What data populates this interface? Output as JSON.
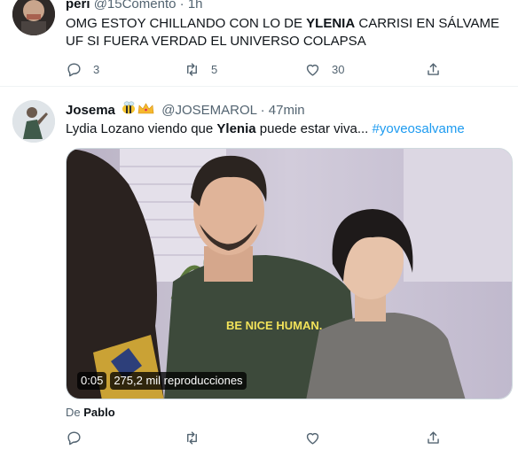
{
  "tweets": [
    {
      "name": "peri",
      "handle": "@15Comento",
      "separator": "·",
      "time": "1h",
      "text_pre": "OMG ESTOY CHILLANDO CON LO DE ",
      "text_bold": "YLENIA",
      "text_post": " CARRISI EN SÁLVAME UF SI FUERA VERDAD EL UNIVERSO COLAPSA",
      "replies": "3",
      "retweets": "5",
      "likes": "30"
    },
    {
      "name": "Josema",
      "emojis": [
        "bee-icon",
        "crown-icon"
      ],
      "handle": "@JOSEMAROL",
      "separator": "·",
      "time": "47min",
      "text_pre": "Lydia Lozano viendo que ",
      "text_bold": "Ylenia",
      "text_post": " puede estar viva... ",
      "hashtag": "#yoveosalvame",
      "video": {
        "duration": "0:05",
        "views": "275,2 mil reproducciones",
        "shirt_text": "BE NICE HUMAN."
      },
      "attribution_prefix": "De ",
      "attribution_name": "Pablo",
      "replies": "",
      "retweets": "",
      "likes": ""
    }
  ],
  "colors": {
    "text": "#0f1419",
    "secondary": "#536471",
    "link": "#1d9bf0",
    "border": "#eff3f4"
  }
}
